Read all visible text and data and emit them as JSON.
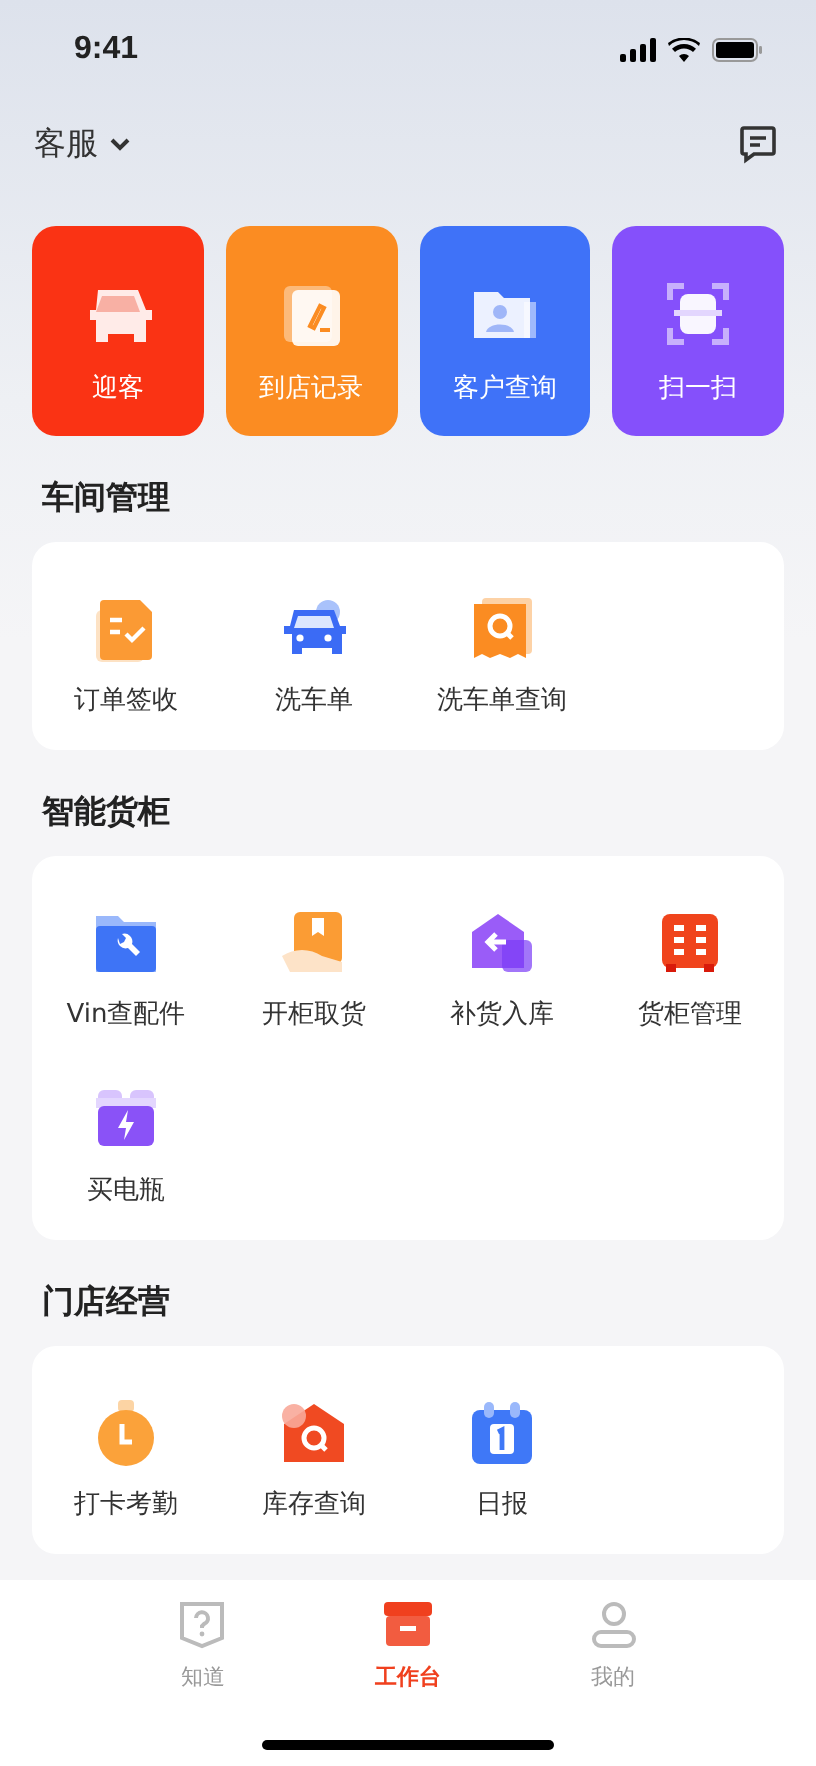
{
  "status_bar": {
    "time": "9:41"
  },
  "header": {
    "title": "客服"
  },
  "quick_actions": [
    {
      "label": "迎客",
      "color": "#fa3314"
    },
    {
      "label": "到店记录",
      "color": "#fb8c22"
    },
    {
      "label": "客户查询",
      "color": "#3f72f8"
    },
    {
      "label": "扫一扫",
      "color": "#8550fb"
    }
  ],
  "sections": [
    {
      "title": "车间管理",
      "items": [
        "订单签收",
        "洗车单",
        "洗车单查询"
      ]
    },
    {
      "title": "智能货柜",
      "items": [
        "Vin查配件",
        "开柜取货",
        "补货入库",
        "货柜管理",
        "买电瓶"
      ]
    },
    {
      "title": "门店经营",
      "items": [
        "打卡考勤",
        "库存查询",
        "日报"
      ]
    }
  ],
  "tab_bar": [
    {
      "label": "知道",
      "selected": false
    },
    {
      "label": "工作台",
      "selected": true
    },
    {
      "label": "我的",
      "selected": false
    }
  ]
}
